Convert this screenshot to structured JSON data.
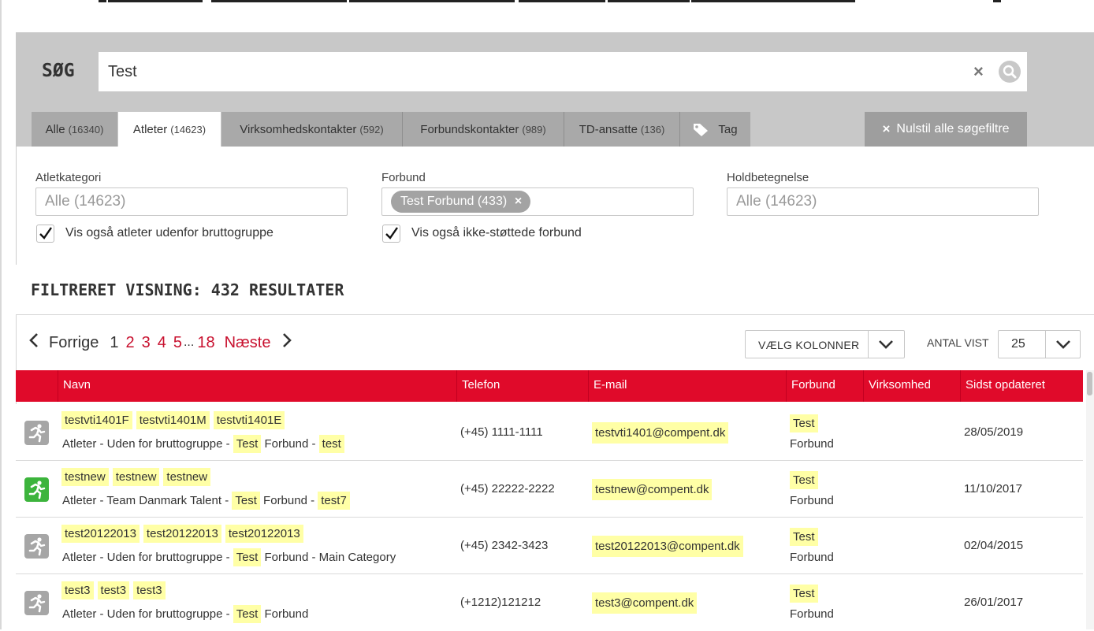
{
  "search": {
    "label": "SØG",
    "value": "Test",
    "clear_glyph": "×"
  },
  "tabs": [
    {
      "label": "Alle",
      "count": "(16340)",
      "active": false
    },
    {
      "label": "Atleter",
      "count": "(14623)",
      "active": true
    },
    {
      "label": "Virksomhedskontakter",
      "count": "(592)",
      "active": false
    },
    {
      "label": "Forbundskontakter",
      "count": "(989)",
      "active": false
    },
    {
      "label": "TD-ansatte",
      "count": "(136)",
      "active": false
    },
    {
      "label": "Tag",
      "count": "",
      "icon": "tag-icon",
      "active": false
    }
  ],
  "reset_button": {
    "label": "Nulstil alle søgefiltre",
    "glyph": "×"
  },
  "filters": {
    "atletkategori": {
      "label": "Atletkategori",
      "placeholder": "Alle (14623)"
    },
    "forbund": {
      "label": "Forbund",
      "chip": "Test Forbund (433)",
      "chip_close": "×"
    },
    "holdbetegnelse": {
      "label": "Holdbetegnelse",
      "placeholder": "Alle (14623)"
    },
    "checkbox_bruttogruppe": {
      "label": "Vis også atleter udenfor bruttogruppe",
      "checked": true
    },
    "checkbox_forbund": {
      "label": "Vis også ikke-støttede forbund",
      "checked": true
    }
  },
  "results_title": "FILTRERET VISNING: 432 RESULTATER",
  "pagination": {
    "prev_label": "Forrige",
    "current": "1",
    "pages": [
      "2",
      "3",
      "4",
      "5"
    ],
    "ellipsis": "...",
    "last": "18",
    "next_label": "Næste"
  },
  "columns_select": {
    "label": "VÆLG KOLONNER"
  },
  "antal_vist": {
    "label": "ANTAL VIST",
    "value": "25"
  },
  "table": {
    "headers": [
      "Navn",
      "Telefon",
      "E-mail",
      "Forbund",
      "Virksomhed",
      "Sidst opdateret"
    ],
    "rows": [
      {
        "names": [
          "testvti1401F",
          "testvti1401M",
          "testvti1401E"
        ],
        "desc_prefix": "Atleter - Uden for bruttogruppe - ",
        "desc_hl1": "Test",
        "desc_mid": " Forbund - ",
        "desc_hl2": "test",
        "desc_suffix": "",
        "phone": "(+45) 1111-1111",
        "email": "testvti1401@compent.dk",
        "forbund_hl": "Test",
        "forbund_rest": "Forbund",
        "virksomhed": "",
        "date": "28/05/2019",
        "status": "grey"
      },
      {
        "names": [
          "testnew",
          "testnew",
          "testnew"
        ],
        "desc_prefix": "Atleter - Team Danmark Talent - ",
        "desc_hl1": "Test",
        "desc_mid": " Forbund - ",
        "desc_hl2": "test7",
        "desc_suffix": "",
        "phone": "(+45) 22222-2222",
        "email": "testnew@compent.dk",
        "forbund_hl": "Test",
        "forbund_rest": "Forbund",
        "virksomhed": "",
        "date": "11/10/2017",
        "status": "green"
      },
      {
        "names": [
          "test20122013",
          "test20122013",
          "test20122013"
        ],
        "desc_prefix": "Atleter - Uden for bruttogruppe - ",
        "desc_hl1": "Test",
        "desc_mid": " Forbund - Main Category",
        "desc_hl2": "",
        "desc_suffix": "",
        "phone": "(+45) 2342-3423",
        "email": "test20122013@compent.dk",
        "forbund_hl": "Test",
        "forbund_rest": "Forbund",
        "virksomhed": "",
        "date": "02/04/2015",
        "status": "grey"
      },
      {
        "names": [
          "test3",
          "test3",
          "test3"
        ],
        "desc_prefix": "Atleter - Uden for bruttogruppe - ",
        "desc_hl1": "Test",
        "desc_mid": " Forbund",
        "desc_hl2": "",
        "desc_suffix": "",
        "phone": "(+1212)121212",
        "email": "test3@compent.dk",
        "forbund_hl": "Test",
        "forbund_rest": "Forbund",
        "virksomhed": "",
        "date": "26/01/2017",
        "status": "grey"
      }
    ]
  },
  "colors": {
    "accent_red": "#e00a2a",
    "link_red": "#c8102e",
    "highlight": "#ffffa6",
    "status_grey": "#a6a6a6",
    "status_green": "#3cb43c"
  }
}
